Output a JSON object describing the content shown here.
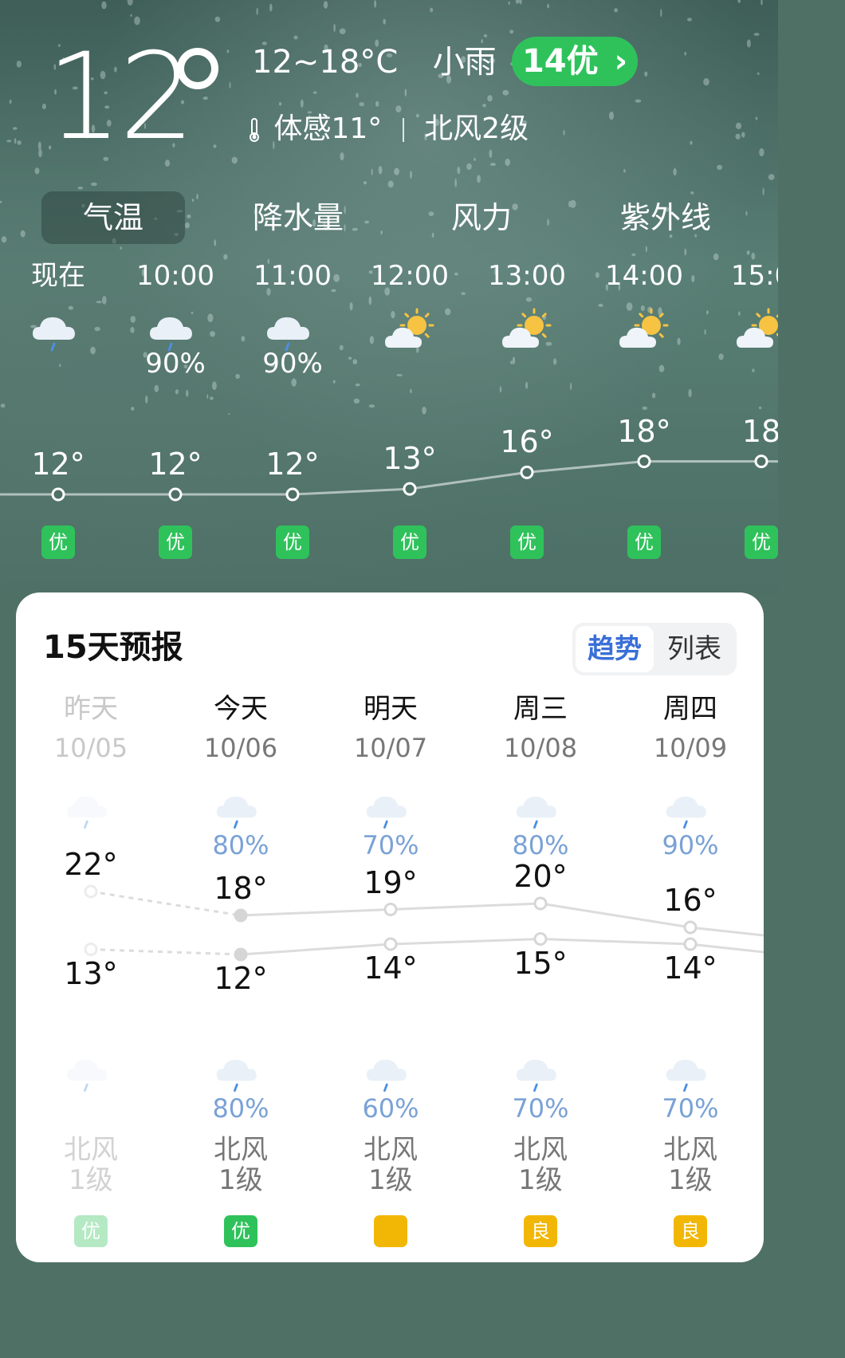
{
  "current": {
    "temp": "12",
    "range": "12~18°C",
    "condition": "小雨",
    "aqi": "14优",
    "aqi_chevron": "›",
    "feels_like": "体感11°",
    "wind": "北风2级"
  },
  "tabs": [
    {
      "label": "气温",
      "active": true
    },
    {
      "label": "降水量",
      "active": false
    },
    {
      "label": "风力",
      "active": false
    },
    {
      "label": "紫外线",
      "active": false
    }
  ],
  "hourly": [
    {
      "time": "现在",
      "icon": "rain-cloud-icon",
      "prob": "",
      "temp": "12°",
      "temp_value": 12,
      "aqi": "优"
    },
    {
      "time": "10:00",
      "icon": "rain-cloud-icon",
      "prob": "90%",
      "temp": "12°",
      "temp_value": 12,
      "aqi": "优"
    },
    {
      "time": "11:00",
      "icon": "rain-cloud-icon",
      "prob": "90%",
      "temp": "12°",
      "temp_value": 12,
      "aqi": "优"
    },
    {
      "time": "12:00",
      "icon": "partly-cloudy-icon",
      "prob": "",
      "temp": "13°",
      "temp_value": 13,
      "aqi": "优"
    },
    {
      "time": "13:00",
      "icon": "partly-cloudy-icon",
      "prob": "",
      "temp": "16°",
      "temp_value": 16,
      "aqi": "优"
    },
    {
      "time": "14:00",
      "icon": "partly-cloudy-icon",
      "prob": "",
      "temp": "18°",
      "temp_value": 18,
      "aqi": "优"
    },
    {
      "time": "15:0",
      "icon": "partly-cloudy-icon",
      "prob": "",
      "temp": "18",
      "temp_value": 18,
      "aqi": "优"
    }
  ],
  "forecast": {
    "title": "15天预报",
    "view_trend": "趋势",
    "view_list": "列表",
    "days": [
      {
        "name": "昨天",
        "date": "10/05",
        "past": true,
        "day_icon": "rain-cloud-icon",
        "day_prob": "",
        "high": "22°",
        "high_value": 22,
        "low": "13°",
        "low_value": 13,
        "night_icon": "rain-cloud-icon",
        "night_prob": "",
        "wind_dir": "北风",
        "wind_level": "1级",
        "aqi": "优",
        "aqi_level": "good"
      },
      {
        "name": "今天",
        "date": "10/06",
        "past": false,
        "day_icon": "rain-cloud-icon",
        "day_prob": "80%",
        "high": "18°",
        "high_value": 18,
        "low": "12°",
        "low_value": 12,
        "night_icon": "rain-cloud-icon",
        "night_prob": "80%",
        "wind_dir": "北风",
        "wind_level": "1级",
        "aqi": "优",
        "aqi_level": "good"
      },
      {
        "name": "明天",
        "date": "10/07",
        "past": false,
        "day_icon": "rain-cloud-icon",
        "day_prob": "70%",
        "high": "19°",
        "high_value": 19,
        "low": "14°",
        "low_value": 14,
        "night_icon": "rain-cloud-icon",
        "night_prob": "60%",
        "wind_dir": "北风",
        "wind_level": "1级",
        "aqi": "",
        "aqi_level": "fair"
      },
      {
        "name": "周三",
        "date": "10/08",
        "past": false,
        "day_icon": "rain-cloud-icon",
        "day_prob": "80%",
        "high": "20°",
        "high_value": 20,
        "low": "15°",
        "low_value": 15,
        "night_icon": "rain-cloud-icon",
        "night_prob": "70%",
        "wind_dir": "北风",
        "wind_level": "1级",
        "aqi": "良",
        "aqi_level": "fair"
      },
      {
        "name": "周四",
        "date": "10/09",
        "past": false,
        "day_icon": "rain-cloud-icon",
        "day_prob": "90%",
        "high": "16°",
        "high_value": 16,
        "low": "14°",
        "low_value": 14,
        "night_icon": "rain-cloud-icon",
        "night_prob": "70%",
        "wind_dir": "北风",
        "wind_level": "1级",
        "aqi": "良",
        "aqi_level": "fair"
      }
    ]
  },
  "colors": {
    "aqi_good": "#2fc25b",
    "aqi_fair": "#f2b705",
    "accent": "#3a6fd8",
    "prob_text": "#7aa2d6"
  }
}
